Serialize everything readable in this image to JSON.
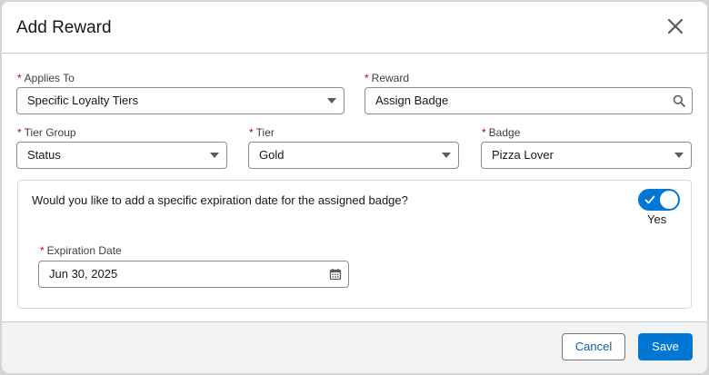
{
  "modal": {
    "title": "Add Reward"
  },
  "fields": {
    "applies_to": {
      "label": "Applies To",
      "value": "Specific Loyalty Tiers",
      "required": true
    },
    "reward": {
      "label": "Reward",
      "value": "Assign Badge",
      "required": true
    },
    "tier_group": {
      "label": "Tier Group",
      "value": "Status",
      "required": true
    },
    "tier": {
      "label": "Tier",
      "value": "Gold",
      "required": true
    },
    "badge": {
      "label": "Badge",
      "value": "Pizza Lover",
      "required": true
    }
  },
  "expiration": {
    "question": "Would you like to add a specific expiration date for the assigned badge?",
    "toggle_state": "on",
    "toggle_label": "Yes",
    "date_label": "Expiration Date",
    "date_value": "Jun 30, 2025"
  },
  "footer": {
    "cancel_label": "Cancel",
    "save_label": "Save"
  },
  "required_marker": "*",
  "icons": {
    "close": "close-icon",
    "search": "search-icon",
    "calendar": "calendar-icon",
    "dropdown": "chevron-down-icon",
    "check": "check-icon"
  },
  "colors": {
    "brand": "#0176d3",
    "required": "#ba0517",
    "link": "#0b5cab"
  }
}
